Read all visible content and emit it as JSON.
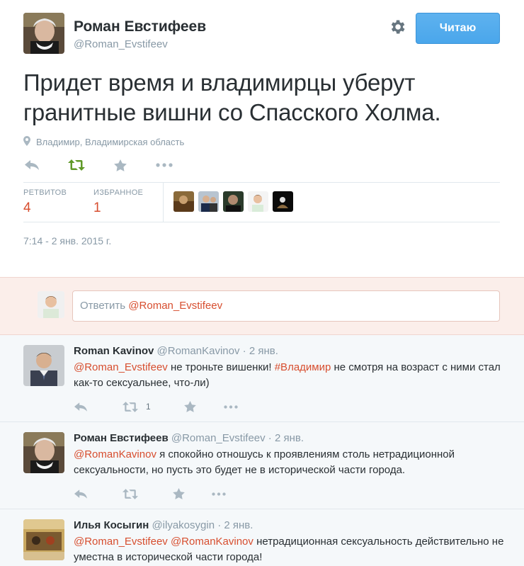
{
  "author": {
    "name": "Роман Евстифеев",
    "handle": "@Roman_Evstifeev"
  },
  "follow_button": "Читаю",
  "tweet": {
    "text": "Придет время и владимирцы уберут гранитные вишни со Спасского Холма.",
    "location": "Владимир, Владимирская область",
    "timestamp": "7:14 - 2 янв. 2015 г."
  },
  "stats": {
    "retweets_label": "РЕТВИТОВ",
    "retweets_count": "4",
    "favorites_label": "ИЗБРАННОЕ",
    "favorites_count": "1"
  },
  "reply_box": {
    "prefix": "Ответить ",
    "mention": "@Roman_Evstifeev"
  },
  "replies": [
    {
      "name": "Roman Kavinov",
      "handle": "@RomanKavinov",
      "time": "2 янв.",
      "mention1": "@Roman_Evstifeev",
      "text_a": " не троньте вишенки! ",
      "hashtag": "#Владимир",
      "text_b": " не смотря на возраст с ними стал как-то сексуальнее, что-ли)",
      "retweet_count": "1"
    },
    {
      "name": "Роман Евстифеев",
      "handle": "@Roman_Evstifeev",
      "time": "2 янв.",
      "mention1": "@RomanKavinov",
      "text_a": " я спокойно отношусь к проявлениям столь нетрадиционной сексуальности, но пусть это будет  не в исторической части города."
    },
    {
      "name": "Илья Косыгин",
      "handle": "@ilyakosygin",
      "time": "2 янв.",
      "mention1": "@Roman_Evstifeev",
      "mention2": "@RomanKavinov",
      "text_a": " нетрадиционная сексуальность действительно не уместна в исторической части города!"
    }
  ],
  "colors": {
    "accent": "#55acee",
    "link": "#d74e2f",
    "muted": "#8899a6",
    "retweet_green": "#19cf86"
  }
}
